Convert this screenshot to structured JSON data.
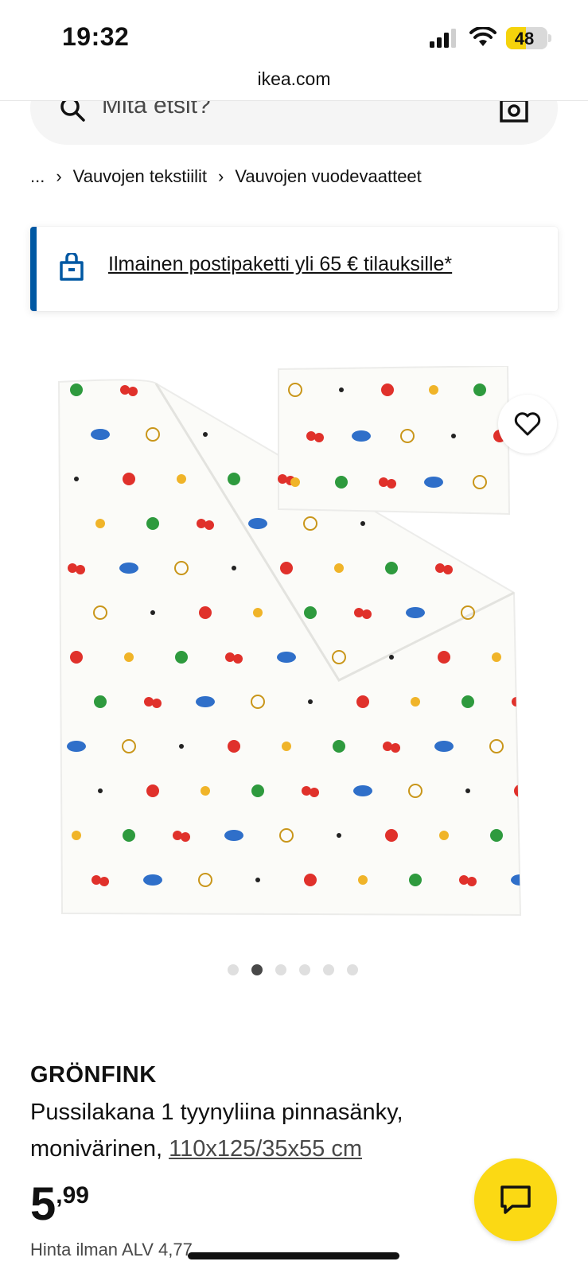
{
  "status_bar": {
    "time": "19:32",
    "battery": "48",
    "battery_level": 0.48
  },
  "browser": {
    "url": "ikea.com"
  },
  "search": {
    "placeholder": "Mitä etsit?"
  },
  "breadcrumb": {
    "items": [
      "...",
      "Vauvojen tekstiilit",
      "Vauvojen vuodevaatteet"
    ]
  },
  "promo": {
    "text": "Ilmainen postipaketti yli 65 € tilauksille*",
    "accent_color": "#0058a3"
  },
  "carousel": {
    "count": 6,
    "active_index": 1
  },
  "product": {
    "name": "GRÖNFINK",
    "description": "Pussilakana 1 tyynyliina pinnasänky, monivärinen,",
    "size": "110x125/35x55 cm",
    "price_integer": "5",
    "price_decimal": ",99",
    "price_ex_vat": "Hinta ilman ALV 4,77"
  },
  "colors": {
    "chat_button": "#fbd914",
    "brand_blue": "#0058a3"
  },
  "icons": [
    "search-icon",
    "camera-icon",
    "store-icon",
    "heart-icon",
    "chat-icon"
  ]
}
